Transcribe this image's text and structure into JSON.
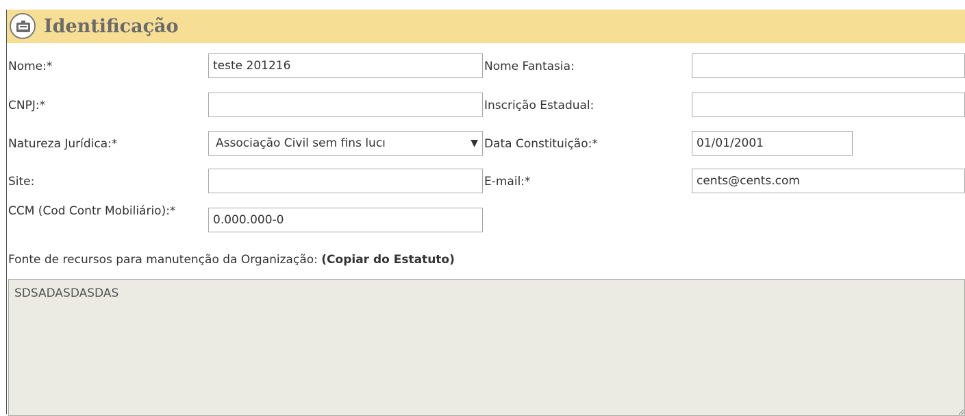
{
  "section": {
    "title": "Identificação",
    "icon": "identification-card-icon"
  },
  "fields": {
    "nome": {
      "label": "Nome:*",
      "value": "teste 201216"
    },
    "nome_fantasia": {
      "label": "Nome Fantasia:",
      "value": ""
    },
    "cnpj": {
      "label": "CNPJ:*",
      "value": ""
    },
    "inscricao_estadual": {
      "label": "Inscrição Estadual:",
      "value": ""
    },
    "natureza_juridica": {
      "label": "Natureza Jurídica:*",
      "value": "Associação Civil sem fins lucı"
    },
    "data_constituicao": {
      "label": "Data Constituição:*",
      "value": "01/01/2001"
    },
    "site": {
      "label": "Site:",
      "value": ""
    },
    "email": {
      "label": "E-mail:*",
      "value": "cents@cents.com"
    },
    "ccm": {
      "label": "CCM (Cod Contr Mobiliário):*",
      "value": "0.000.000-0"
    }
  },
  "fonte": {
    "label": "Fonte de recursos para manutenção da Organização:",
    "emphasis": "(Copiar do Estatuto)",
    "value": "SDSADASDASDAS"
  },
  "colors": {
    "header_bg": "#f6df94",
    "readonly_bg": "#ebebe4"
  }
}
